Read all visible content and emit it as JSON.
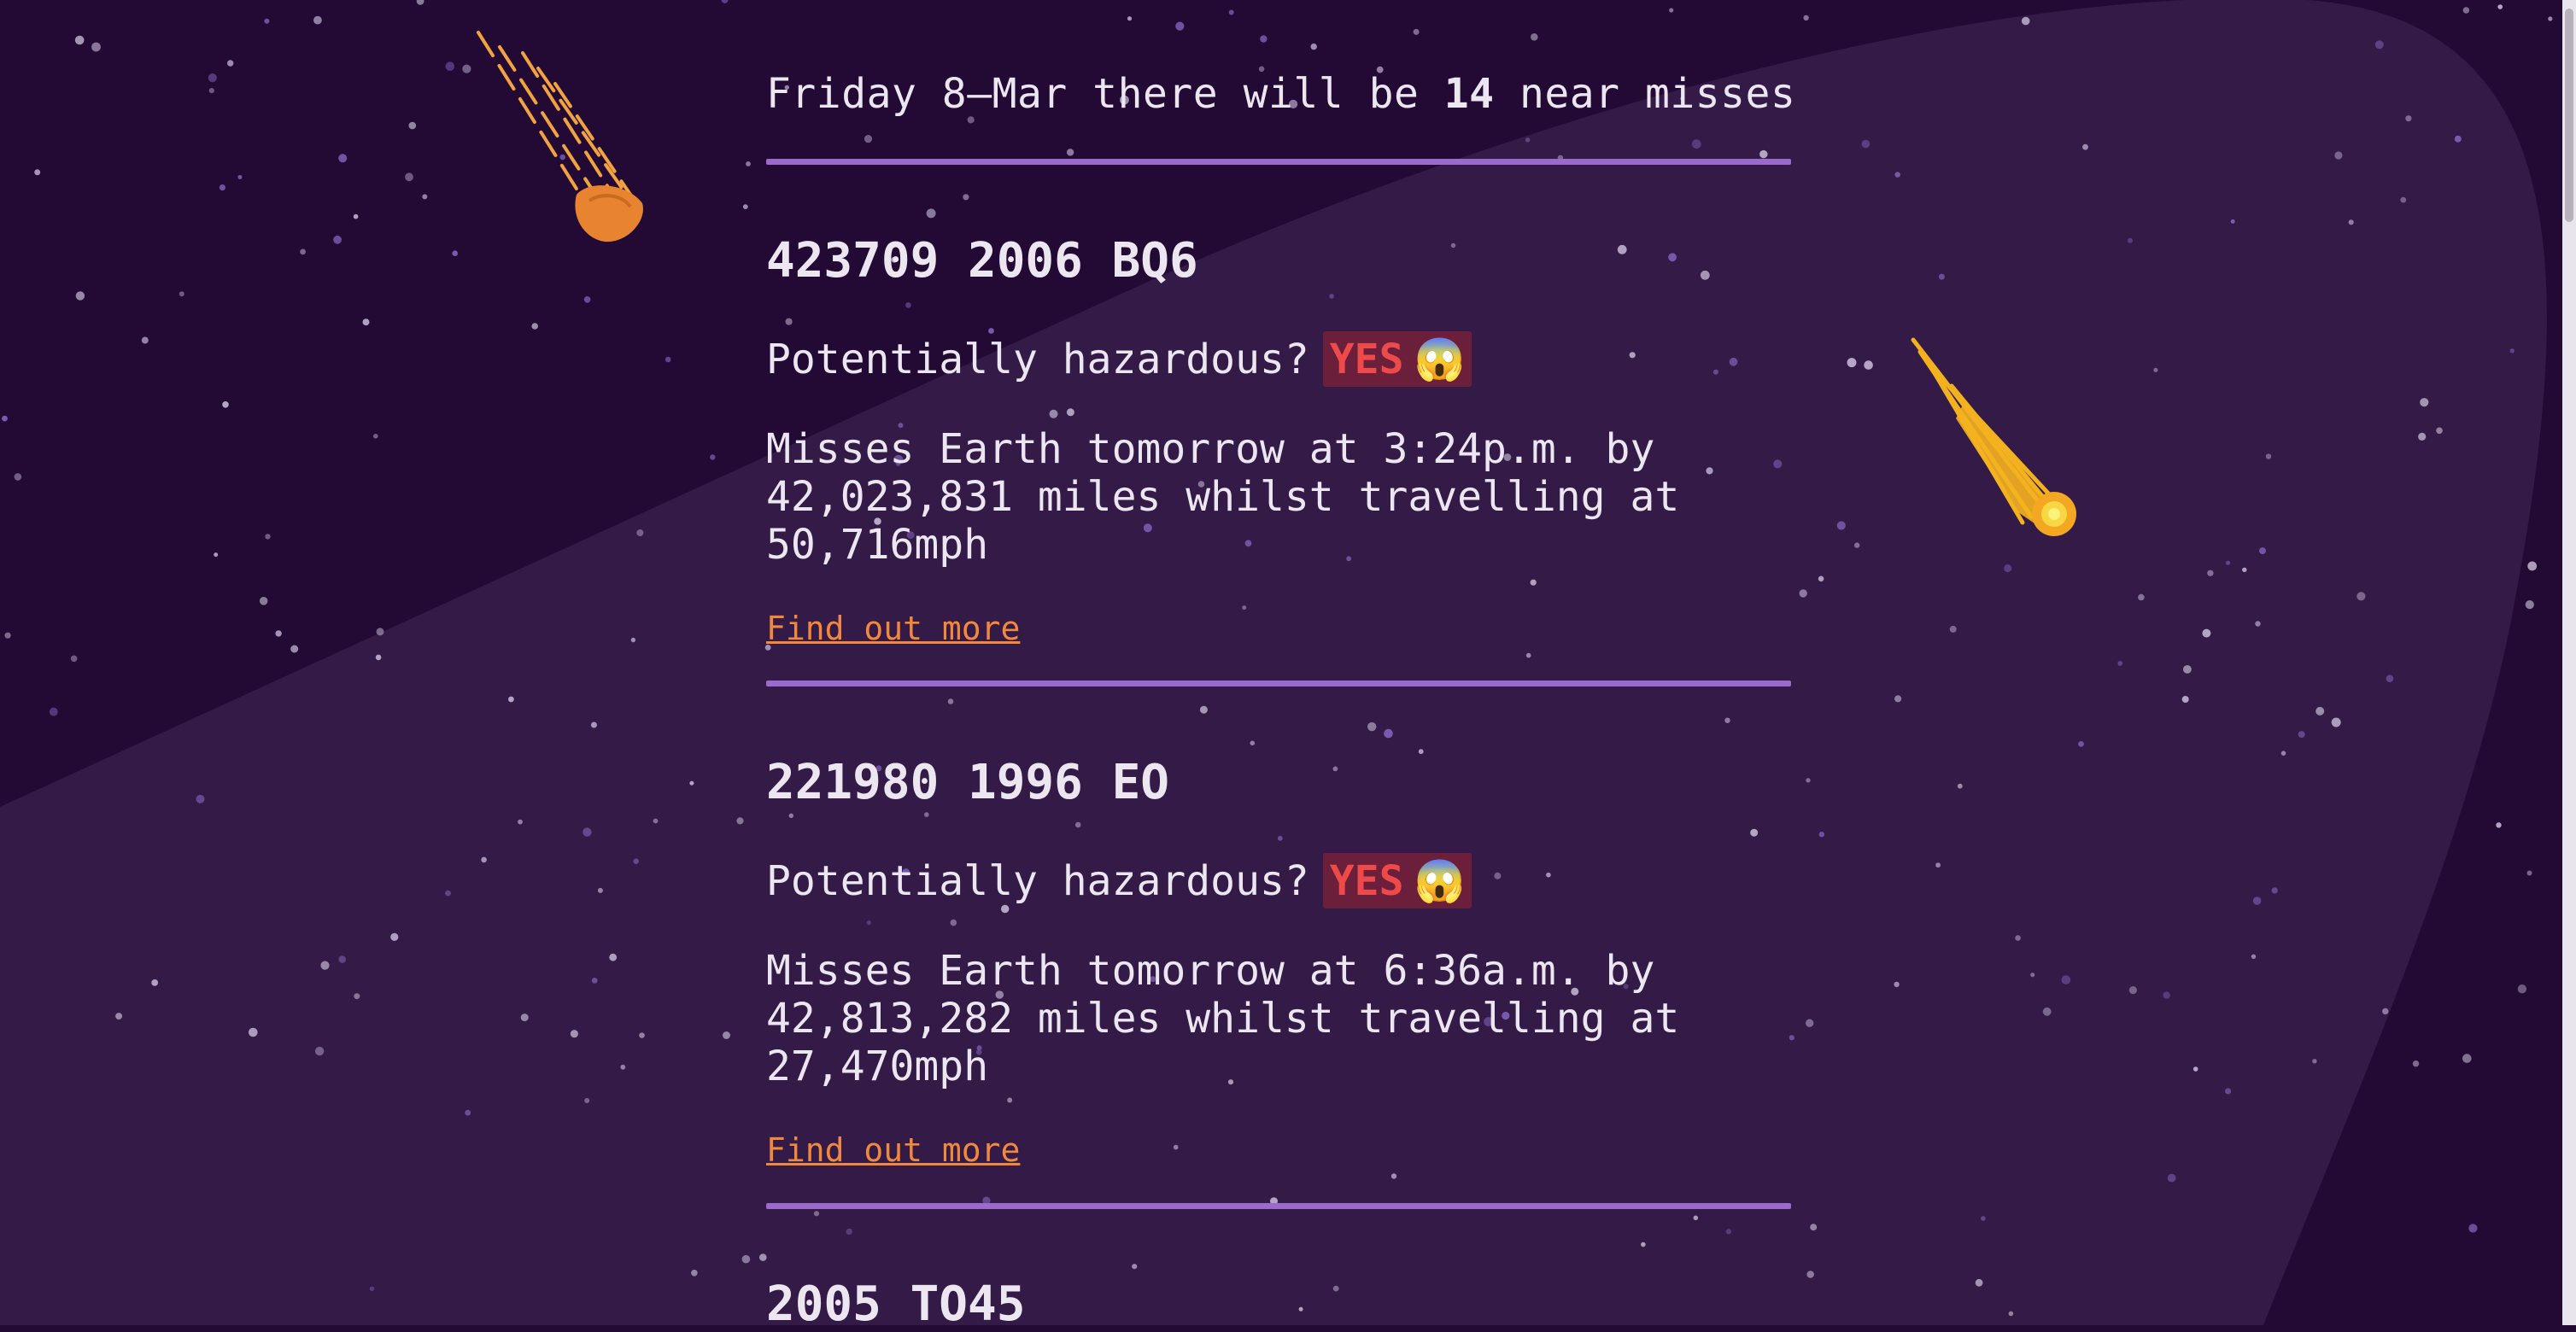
{
  "header": {
    "prefix": "Friday 8–Mar there will be",
    "count": "14",
    "suffix": "near misses"
  },
  "asteroids": [
    {
      "name": "423709 2006 BQ6",
      "hazard_label": "Potentially hazardous?",
      "hazard_value": "YES",
      "hazard_emoji": "😱",
      "description": "Misses Earth tomorrow at 3:24p.m. by 42,023,831 miles whilst travelling at 50,716mph",
      "link_label": "Find out more"
    },
    {
      "name": "221980 1996 EO",
      "hazard_label": "Potentially hazardous?",
      "hazard_value": "YES",
      "hazard_emoji": "😱",
      "description": "Misses Earth tomorrow at 6:36a.m. by 42,813,282 miles whilst travelling at 27,470mph",
      "link_label": "Find out more"
    },
    {
      "name": "2005 TO45"
    }
  ],
  "colors": {
    "background": "#230a35",
    "panel": "#341b47",
    "divider": "#9a6bcd",
    "link": "#f0883e",
    "hazard_text": "#ef4a4a",
    "hazard_bg": "#6b1f3a"
  },
  "icons": {
    "meteor_left": "meteor-icon",
    "comet_right": "comet-icon"
  }
}
